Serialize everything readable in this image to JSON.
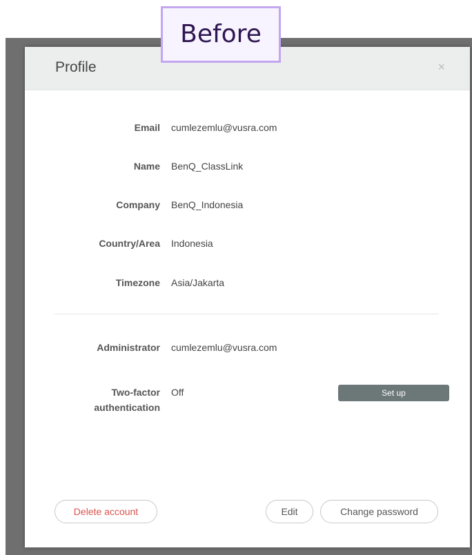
{
  "overlay_label": "Before",
  "modal": {
    "title": "Profile",
    "close_glyph": "×"
  },
  "fields": [
    {
      "label": "Email",
      "value": "cumlezemlu@vusra.com"
    },
    {
      "label": "Name",
      "value": "BenQ_ClassLink"
    },
    {
      "label": "Company",
      "value": "BenQ_Indonesia"
    },
    {
      "label": "Country/Area",
      "value": "Indonesia"
    },
    {
      "label": "Timezone",
      "value": "Asia/Jakarta"
    }
  ],
  "admin": {
    "label": "Administrator",
    "value": "cumlezemlu@vusra.com"
  },
  "two_factor": {
    "label_line1": "Two-factor",
    "label_line2": "authentication",
    "value": "Off",
    "setup_label": "Set up"
  },
  "actions": {
    "delete_label": "Delete account",
    "edit_label": "Edit",
    "change_password_label": "Change password"
  },
  "colors": {
    "delete_text": "#d9534f",
    "setup_button": "#6c7777",
    "header_bg": "#eceeee",
    "overlay_border": "#c3a5f0"
  }
}
